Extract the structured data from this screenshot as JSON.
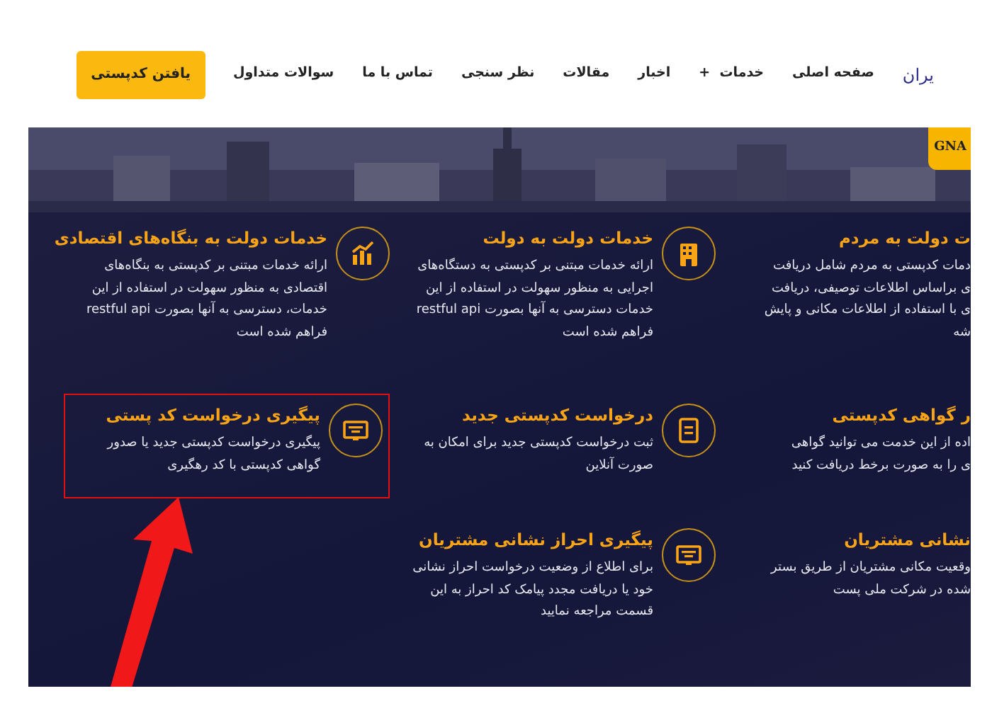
{
  "navbar": {
    "brand": "یران",
    "items": [
      {
        "label": "صفحه اصلی",
        "kind": "link"
      },
      {
        "label": "خدمات",
        "kind": "dropdown",
        "toggle": "+"
      },
      {
        "label": "اخبار",
        "kind": "link"
      },
      {
        "label": "مقالات",
        "kind": "link"
      },
      {
        "label": "نظر سنجی",
        "kind": "link"
      },
      {
        "label": "تماس با ما",
        "kind": "link"
      },
      {
        "label": "سوالات متداول",
        "kind": "link"
      }
    ],
    "cta": "یافتن کدپستی"
  },
  "hero": {
    "kind": "picture",
    "badge": "GNA"
  },
  "services": [
    {
      "title": "ت دولت به مردم",
      "kind": "partial",
      "lines": [
        "دمات کدپستی به مردم شامل دریافت",
        "ی براساس اطلاعات توصیفی، دریافت",
        "ی با استفاده از اطلاعات مکانی و پایش",
        "شه"
      ],
      "highlighted": false
    },
    {
      "title": "خدمات دولت به دولت",
      "kind": "building",
      "lines": [
        "ارائه خدمات مبتنی بر کدپستی به دستگاه‌های",
        "اجرایی به منظور سهولت در استفاده از این",
        "خدمات دسترسی به آنها بصورت restful api",
        "فراهم شده است"
      ],
      "highlighted": false
    },
    {
      "title": "خدمات دولت به بنگاه‌های اقتصادی",
      "kind": "chart",
      "lines": [
        "ارائه خدمات مبتنی بر کدپستی به بنگاه‌های",
        "اقتصادی به منظور سهولت در استفاده از این",
        "خدمات، دسترسی به آنها بصورت restful api",
        "فراهم شده است"
      ],
      "highlighted": false
    },
    {
      "title": "ر گواهی کدپستی",
      "kind": "partial",
      "lines": [
        "اده از این خدمت می توانید گواهی",
        "ی را به صورت برخط دریافت کنید"
      ],
      "highlighted": false
    },
    {
      "title": "درخواست کدپستی جدید",
      "kind": "document",
      "lines": [
        "ثبت درخواست کدپستی جدید برای امکان به",
        "صورت آنلاین"
      ],
      "highlighted": false
    },
    {
      "title": "پیگیری درخواست کد پستی",
      "kind": "screen",
      "lines": [
        "پیگیری درخواست کدپستی جدید یا صدور",
        "گواهی کدپستی با کد رهگیری"
      ],
      "highlighted": true
    },
    {
      "title": "نشانی مشتریان",
      "kind": "partial",
      "lines": [
        "وقعیت مکانی مشتریان از طریق بستر",
        "شده در شرکت ملی پست"
      ],
      "highlighted": false
    },
    {
      "title": "پیگیری احراز نشانی مشتریان",
      "kind": "screen",
      "lines": [
        "برای اطلاع از وضعیت درخواست احراز نشانی",
        "خود یا دریافت مجدد پیامک کد احراز به این",
        "قسمت مراجعه نمایید"
      ],
      "highlighted": false
    }
  ]
}
